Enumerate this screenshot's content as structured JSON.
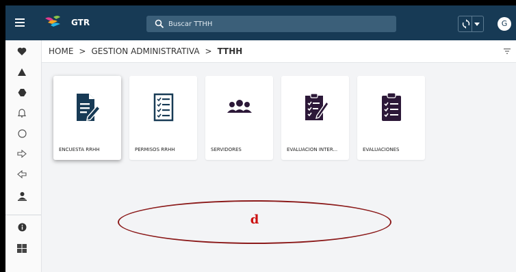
{
  "header": {
    "menu_icon": "hamburger-icon",
    "logo_icon": "bird-logo-icon",
    "title": "GTR",
    "search_placeholder": "Buscar TTHH",
    "avatar_letter": "G",
    "colors": {
      "bar": "#173a55",
      "search": "#3b5f79"
    }
  },
  "sidebar": {
    "items": [
      {
        "icon": "heart-icon"
      },
      {
        "icon": "triangle-icon"
      },
      {
        "icon": "hexagon-icon"
      },
      {
        "icon": "bell-icon"
      },
      {
        "icon": "circle-icon"
      },
      {
        "icon": "arrow-right-icon"
      },
      {
        "icon": "arrow-left-icon"
      },
      {
        "icon": "user-icon"
      },
      {
        "icon": "info-icon"
      },
      {
        "icon": "grid-icon"
      }
    ]
  },
  "breadcrumb": {
    "items": [
      "HOME",
      "GESTION ADMINISTRATIVA",
      "TTHH"
    ],
    "separator": ">"
  },
  "cards": [
    {
      "label": "ENCUESTA RRHH",
      "icon": "survey-edit-icon"
    },
    {
      "label": "PERMISOS RRHH",
      "icon": "list-document-icon"
    },
    {
      "label": "SERVIDORES",
      "icon": "users-icon"
    },
    {
      "label": "EVALUACION INTER...",
      "icon": "clipboard-check-icon"
    },
    {
      "label": "EVALUACIONES",
      "icon": "clipboard-list-icon"
    }
  ],
  "annotation": {
    "letter": "d",
    "color": "#8b1a1a"
  }
}
